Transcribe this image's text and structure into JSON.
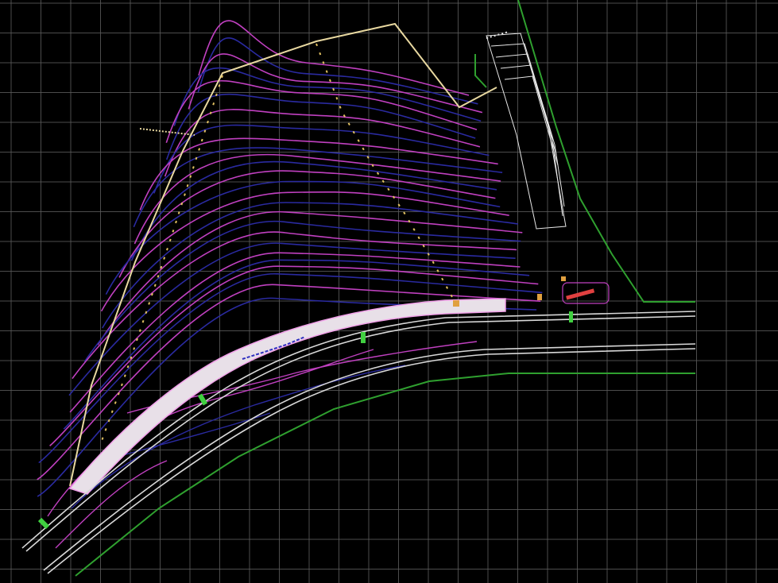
{
  "drawing": {
    "background": "#000000",
    "grid_color": "#5a5a5a",
    "colors": {
      "contour_major": "#c040c0",
      "contour_minor": "#2a2aa0",
      "boundary": "#e8d8a0",
      "road_edge": "#d8d8d8",
      "right_of_way": "#2fa02f",
      "retaining_strip": "#e8e0e8",
      "markers": "#40d040",
      "annotation": "#e0c060",
      "highlight": "#e04040"
    },
    "layers": [
      "grid",
      "contours",
      "boundary",
      "road",
      "right-of-way",
      "annotations"
    ]
  }
}
